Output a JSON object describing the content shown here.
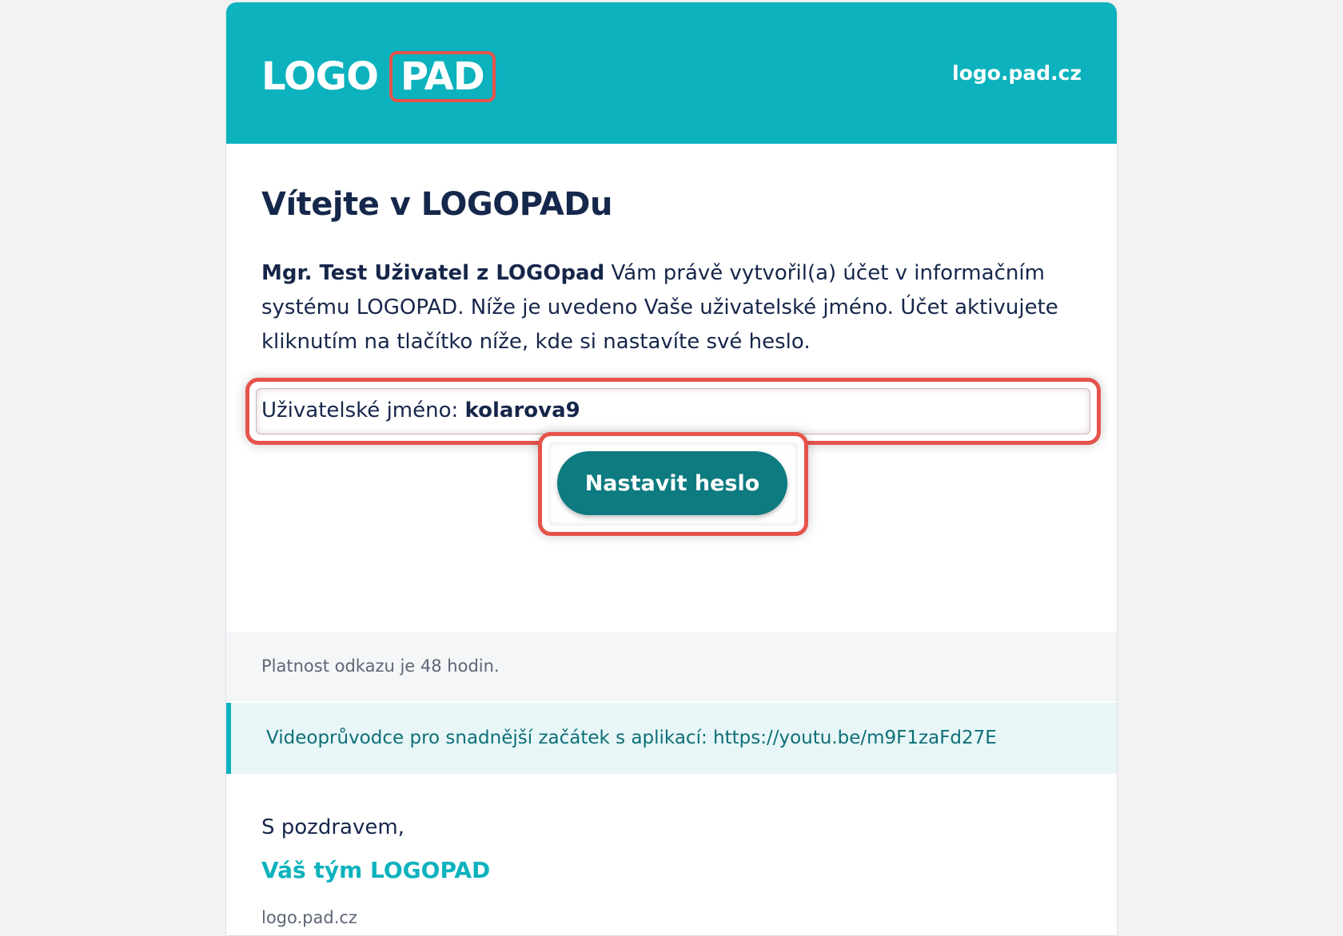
{
  "header": {
    "logo_part1": "LOGO",
    "logo_part2": "PAD",
    "site_link": "logo.pad.cz",
    "bg_color": "#0cb2bd"
  },
  "main": {
    "title": "Vítejte v LOGOPADu",
    "intro_author": "Mgr. Test Uživatel z LOGOpad",
    "intro_text": " Vám právě vytvořil(a) účet v informačním systému LOGOPAD. Níže je uvedeno Vaše uživatelské jméno. Účet aktivujete kliknutím na tlačítko níže, kde si nastavíte své heslo.",
    "username_label": "Uživatelské jméno: ",
    "username_value": "kolarova9",
    "button_label": "Nastavit heslo",
    "button_color": "#0d7b80",
    "highlight_color": "#e5534b"
  },
  "info": {
    "validity_text": "Platnost odkazu je 48 hodin.",
    "video_text": "Videoprůvodce pro snadnější začátek s aplikací: https://youtu.be/m9F1zaFd27E"
  },
  "signature": {
    "greeting": "S pozdravem,",
    "team": "Váš tým LOGOPAD",
    "footer_link": "logo.pad.cz"
  }
}
